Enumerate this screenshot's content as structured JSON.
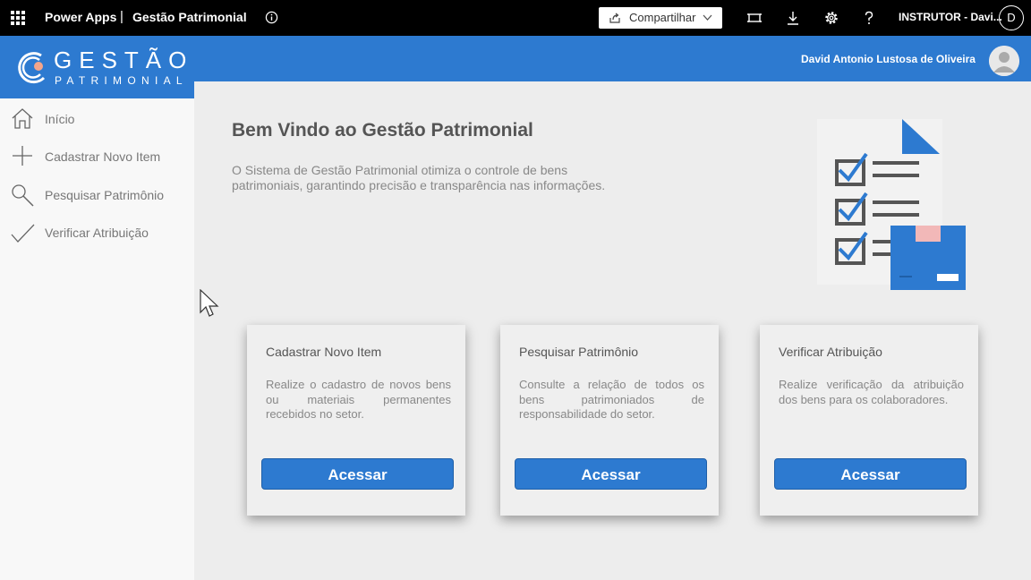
{
  "topbar": {
    "app_name": "Power Apps",
    "separator": "|",
    "app_title": "Gestão Patrimonial",
    "share_label": "Compartilhar",
    "user_label": "INSTRUTOR - Davi...",
    "user_initial": "D",
    "icons": [
      "waffle-icon",
      "info-icon",
      "share-icon",
      "chevron-down-icon",
      "fit-screen-icon",
      "download-icon",
      "gear-icon",
      "help-icon"
    ]
  },
  "header": {
    "logo_line1": "GESTÃO",
    "logo_line2": "PATRIMONIAL",
    "user_full_name": "David Antonio Lustosa de Oliveira"
  },
  "sidebar": {
    "items": [
      {
        "label": "Início",
        "icon": "home-icon"
      },
      {
        "label": "Cadastrar Novo Item",
        "icon": "plus-icon"
      },
      {
        "label": "Pesquisar Patrimônio",
        "icon": "search-icon"
      },
      {
        "label": "Verificar Atribuição",
        "icon": "check-icon"
      }
    ]
  },
  "main": {
    "welcome_title": "Bem Vindo ao Gestão Patrimonial",
    "intro": "O Sistema de Gestão Patrimonial otimiza o controle de bens patrimoniais, garantindo precisão e transparência nas informações."
  },
  "cards": [
    {
      "title": "Cadastrar Novo Item",
      "text": "Realize o cadastro de novos bens ou materiais permanentes recebidos no setor.",
      "button": "Acessar"
    },
    {
      "title": "Pesquisar Patrimônio",
      "text": "Consulte a relação de todos os bens patrimoniados de responsabilidade do setor.",
      "button": "Acessar"
    },
    {
      "title": "Verificar Atribuição",
      "text": "Realize verificação da atribuição dos bens para os colaboradores.",
      "button": "Acessar"
    }
  ],
  "colors": {
    "topbar": "#000000",
    "header": "#2d7ad0",
    "sidebar": "#f8f8f8",
    "content": "#ededed",
    "button": "#2d7ad0"
  }
}
